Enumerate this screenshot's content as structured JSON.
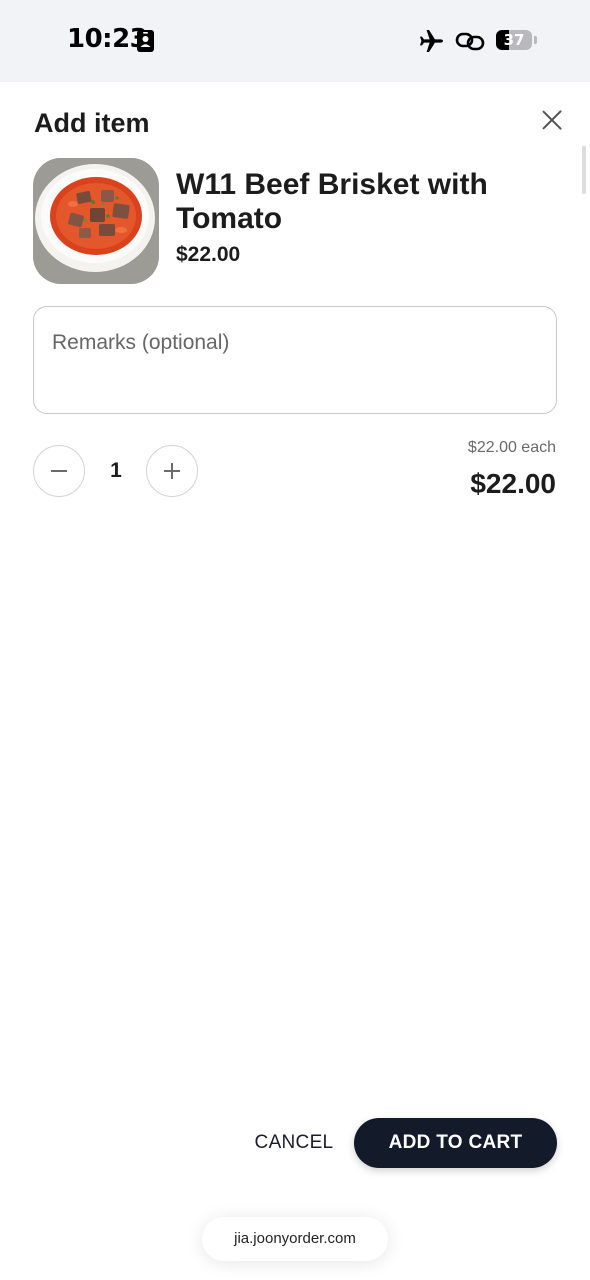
{
  "status_bar": {
    "time": "10:23",
    "battery_level": "37",
    "battery_percent": 37
  },
  "dialog": {
    "title": "Add item",
    "close_icon": "close-icon"
  },
  "item": {
    "name": "W11 Beef Brisket with Tomato",
    "price": "$22.00",
    "image_subject": "bowl of beef brisket in tomato soup"
  },
  "remarks": {
    "placeholder": "Remarks (optional)",
    "value": ""
  },
  "quantity": {
    "value": "1",
    "each_label": "$22.00 each",
    "total": "$22.00"
  },
  "actions": {
    "cancel": "CANCEL",
    "add_to_cart": "ADD TO CART"
  },
  "browser": {
    "url": "jia.joonyorder.com"
  },
  "colors": {
    "primary_button": "#131a2a",
    "status_bar_bg": "#f2f3f7"
  }
}
